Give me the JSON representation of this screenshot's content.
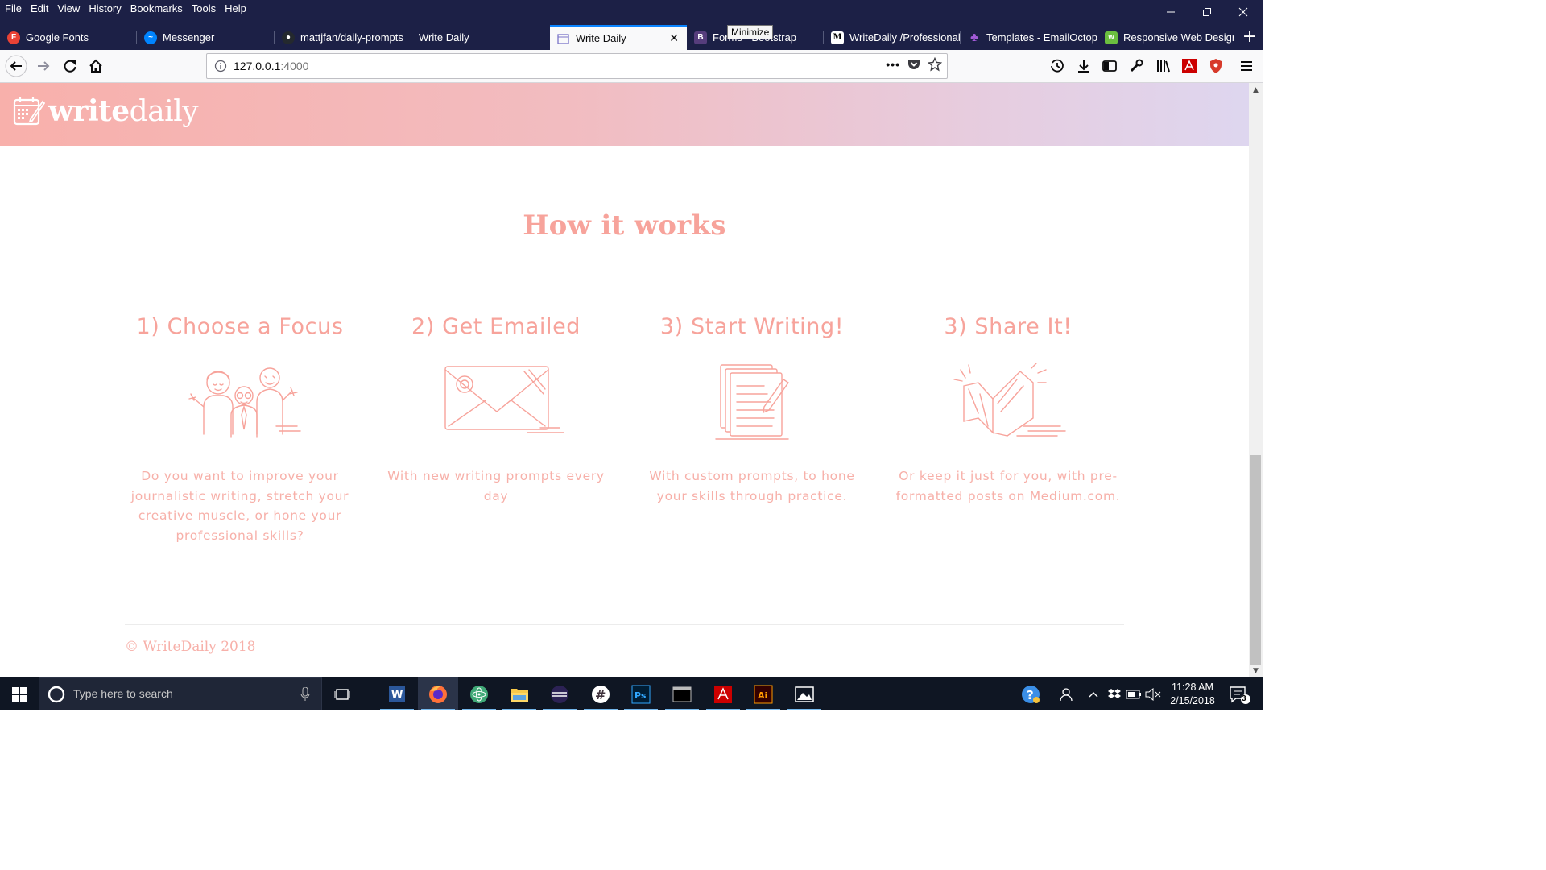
{
  "menu": [
    "File",
    "Edit",
    "View",
    "History",
    "Bookmarks",
    "Tools",
    "Help"
  ],
  "tabs": [
    {
      "label": "Google Fonts",
      "icon": "google-fonts-icon"
    },
    {
      "label": "Messenger",
      "icon": "messenger-icon"
    },
    {
      "label": "mattjfan/daily-prompts",
      "icon": "github-icon"
    },
    {
      "label": "Write Daily",
      "icon": ""
    },
    {
      "label": "Write Daily",
      "icon": "writedaily-icon",
      "active": true
    },
    {
      "label": "Forms · Bootstrap",
      "icon": "bootstrap-icon"
    },
    {
      "label": "WriteDaily /Professional",
      "icon": "medium-icon"
    },
    {
      "label": "Templates - EmailOctopus",
      "icon": "emailoctopus-icon"
    },
    {
      "label": "Responsive Web Design",
      "icon": "web-design-icon"
    }
  ],
  "tooltip": "Minimize",
  "url": {
    "host": "127.0.0.1",
    "port": ":4000"
  },
  "site": {
    "logo_bold": "write",
    "logo_light": "daily",
    "section_title": "How it works",
    "steps": [
      {
        "title": "1) Choose a Focus",
        "desc": "Do you want to improve your journalistic writing, stretch your creative muscle, or hone your professional skills?",
        "icon": "people-icon"
      },
      {
        "title": "2) Get Emailed",
        "desc": "With new writing prompts every day",
        "icon": "envelope-icon"
      },
      {
        "title": "3) Start Writing!",
        "desc": "With custom prompts, to hone your skills through practice.",
        "icon": "notepad-icon"
      },
      {
        "title": "3) Share It!",
        "desc": "Or keep it just for you, with pre-formatted posts on Medium.com.",
        "icon": "open-book-icon"
      }
    ],
    "footer": "© WriteDaily 2018"
  },
  "taskbar": {
    "search_placeholder": "Type here to search",
    "time": "11:28 AM",
    "date": "2/15/2018",
    "notifications": "3"
  },
  "colors": {
    "accent": "#f7a39b",
    "chrome_dark": "#1c2046",
    "tab_highlight": "#0a84ff"
  }
}
